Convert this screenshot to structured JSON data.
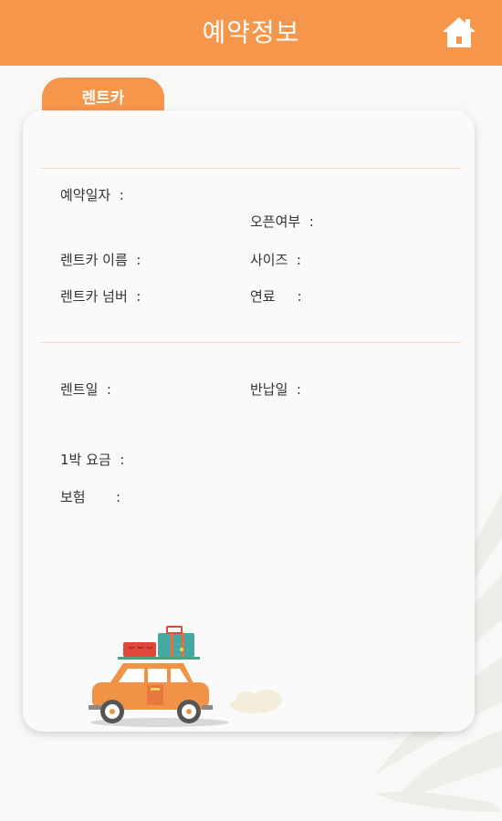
{
  "header": {
    "title": "예약정보",
    "home_icon": "home-icon",
    "color": "#f6964a"
  },
  "tab": {
    "label": "렌트카"
  },
  "details": {
    "reservation_date": "예약일자  :",
    "open_status": "오픈여부  :",
    "car_name": "렌트카 이름  :",
    "size": "사이즈  :",
    "car_number": "렌트카 넘버  :",
    "fuel": "연료     :"
  },
  "dates": {
    "rent_date": "렌트일  :",
    "return_date": "반납일  :"
  },
  "charges": {
    "nightly_rate": "1박 요금  :",
    "insurance": "보험       :"
  },
  "illustration": {
    "icon": "car-with-luggage-icon"
  }
}
